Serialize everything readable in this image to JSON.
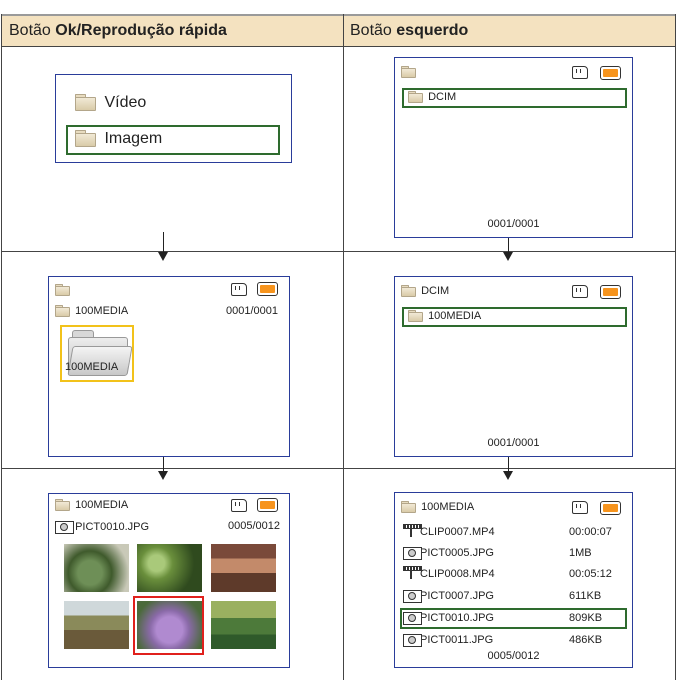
{
  "headers": {
    "left": {
      "prefix": "Botão ",
      "bold": "Ok/Reprodução rápida"
    },
    "right": {
      "prefix": "Botão ",
      "bold": "esquerdo"
    }
  },
  "colors": {
    "header_bg": "#f4e2c0",
    "screen_border": "#2a3d9a",
    "selection_green": "#2e6b2e",
    "selection_yellow": "#f2c21a",
    "selection_red": "#e0201c",
    "battery": "#f7941d"
  },
  "left_col": {
    "screen1": {
      "items": [
        "Vídeo",
        "Imagem"
      ],
      "selected_index": 1
    },
    "screen2": {
      "folder_name": "100MEDIA",
      "counter": "0001/0001",
      "big_folder_label": "100MEDIA"
    },
    "screen3": {
      "folder_name": "100MEDIA",
      "file_name": "PICT0010.JPG",
      "counter": "0005/0012",
      "selected_thumb_index": 4
    }
  },
  "right_col": {
    "screen1": {
      "folder_name": "DCIM",
      "counter": "0001/0001"
    },
    "screen2": {
      "parent_folder": "DCIM",
      "folder_name": "100MEDIA",
      "counter": "0001/0001"
    },
    "screen3": {
      "folder_name": "100MEDIA",
      "files": [
        {
          "icon": "film-icon",
          "name": "CLIP0007.MP4",
          "info": "00:00:07"
        },
        {
          "icon": "camera-icon",
          "name": "PICT0005.JPG",
          "info": "1MB"
        },
        {
          "icon": "film-icon",
          "name": "CLIP0008.MP4",
          "info": "00:05:12"
        },
        {
          "icon": "camera-icon",
          "name": "PICT0007.JPG",
          "info": "611KB"
        },
        {
          "icon": "camera-icon",
          "name": "PICT0010.JPG",
          "info": "809KB"
        },
        {
          "icon": "camera-icon",
          "name": "PICT0011.JPG",
          "info": "486KB"
        }
      ],
      "selected_index": 4,
      "counter": "0005/0012"
    }
  }
}
